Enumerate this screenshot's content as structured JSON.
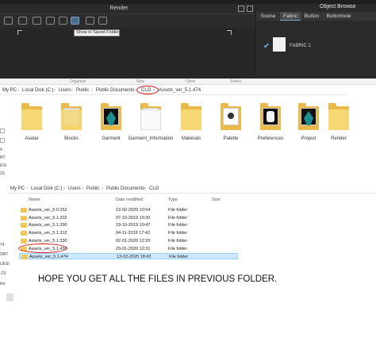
{
  "render_panel": {
    "title": "Render",
    "tooltip": "Show in Saved Folder"
  },
  "object_browser": {
    "title": "Object Browse",
    "tabs": [
      "Scene",
      "Fabric",
      "Button",
      "Buttonhole"
    ],
    "active_tab": "Fabric",
    "item_label": "FABRIC 1"
  },
  "ribbon": {
    "groups": [
      "Organize",
      "New",
      "Open",
      "Select"
    ]
  },
  "explorer1": {
    "breadcrumb": [
      "My PC",
      "Local Disk (C:)",
      "Users",
      "Public",
      "Public Documents",
      "CLO",
      "Assets_ver_5.1.474"
    ],
    "items": [
      "Avatar",
      "Blocks",
      "Garment",
      "Garment_Information",
      "Materials",
      "Palette",
      "Preferences",
      "Project",
      "Render"
    ]
  },
  "sidebar": {
    "fragments": [
      "4",
      "RT",
      "ESI",
      "23",
      "74",
      "ORT",
      "UESI",
      "-23",
      "les"
    ]
  },
  "explorer2": {
    "breadcrumb": [
      "My PC",
      "Local Disk (C:)",
      "Users",
      "Public",
      "Public Documents",
      "CLO"
    ],
    "columns": {
      "name": "Name",
      "date": "Date modified",
      "type": "Type",
      "size": "Size"
    },
    "rows": [
      {
        "name": "Assets_ver_5.0.252",
        "date": "13-02-2020 10:54",
        "type": "File folder"
      },
      {
        "name": "Assets_ver_5.1.202",
        "date": "07-10-2019 19:30",
        "type": "File folder"
      },
      {
        "name": "Assets_ver_5.1.290",
        "date": "19-10-2019 10:47",
        "type": "File folder"
      },
      {
        "name": "Assets_ver_5.1.312",
        "date": "04-11-2019 17:42",
        "type": "File folder"
      },
      {
        "name": "Assets_ver_5.1.330",
        "date": "02-01-2020 12:20",
        "type": "File folder"
      },
      {
        "name": "Assets_ver_5.1.436",
        "date": "29-01-2020 12:31",
        "type": "File folder"
      },
      {
        "name": "Assets_ver_5.1.474",
        "date": "13-02-2020 18:43",
        "type": "File folder"
      }
    ],
    "selected_index": 6
  },
  "note": "HOPE YOU GET ALL THE FILES IN PREVIOUS FOLDER.",
  "colors": {
    "annotation_red": "#d01818",
    "selection": "#cde8ff",
    "folder": "#f7d774"
  }
}
